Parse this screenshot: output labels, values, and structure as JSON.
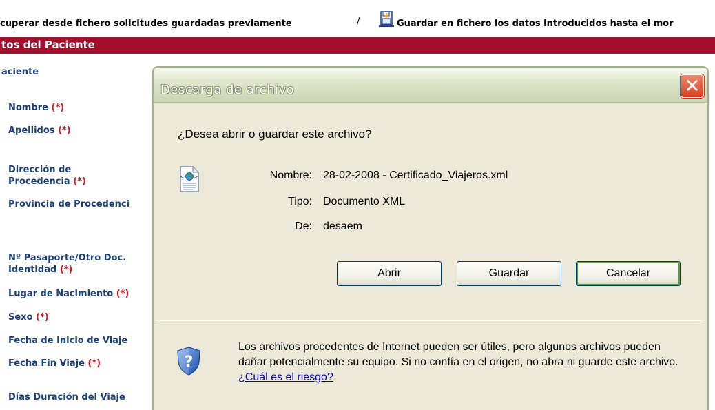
{
  "toolbar": {
    "recover_label": "cuperar desde fichero solicitudes guardadas previamente",
    "separator": "/",
    "save_label": "Guardar en fichero los datos introducidos hasta el mor"
  },
  "section": {
    "title": "tos del Paciente"
  },
  "form": {
    "subsection": "aciente",
    "required_mark": "(*)",
    "labels": {
      "nombre": "Nombre",
      "apellidos": "Apellidos",
      "direccion_1": "Dirección de",
      "direccion_2": "Procedencia",
      "provincia": "Provincia de Procedenci",
      "pasaporte_1": "Nº Pasaporte/Otro Doc.",
      "pasaporte_2": "Identidad",
      "lugar": "Lugar de Nacimiento",
      "sexo": "Sexo",
      "fecha_inicio": "Fecha de Inicio de Viaje",
      "fecha_fin": "Fecha Fin Viaje",
      "dias": "Días Duración del Viaje"
    }
  },
  "dialog": {
    "title": "Descarga de archivo",
    "close_glyph": "✕",
    "question": "¿Desea abrir o guardar este archivo?",
    "file": {
      "name_label": "Nombre:",
      "name_value": "28-02-2008 - Certificado_Viajeros.xml",
      "type_label": "Tipo:",
      "type_value": "Documento XML",
      "from_label": "De:",
      "from_value": "desaem"
    },
    "buttons": {
      "open": "Abrir",
      "save": "Guardar",
      "cancel": "Cancelar"
    },
    "warning_text": "Los archivos procedentes de Internet pueden ser útiles, pero algunos archivos pueden dañar potencialmente su equipo. Si no confía en el origen, no abra ni guarde este archivo.",
    "risk_link": "¿Cuál es el riesgo?"
  },
  "icons": {
    "save_icon": "floppy-save-icon",
    "file_icon": "xml-document-icon",
    "shield_icon": "security-shield-icon",
    "close_icon": "close-icon"
  },
  "colors": {
    "header_bg": "#a4102c",
    "label_color": "#1a3f7a",
    "required_color": "#e0161f",
    "dialog_bg": "#ece9d8",
    "close_red": "#d8401f",
    "link_color": "#0000cc"
  }
}
